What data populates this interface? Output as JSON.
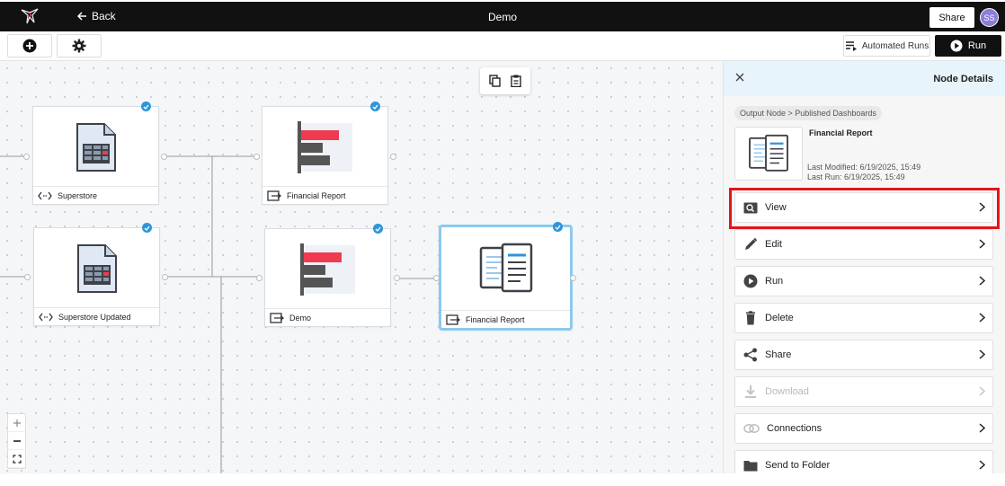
{
  "header": {
    "back_label": "Back",
    "title": "Demo",
    "share_label": "Share",
    "avatar_initials": "SS"
  },
  "toolbar": {
    "automated_runs_label": "Automated Runs",
    "run_label": "Run"
  },
  "canvas": {
    "nodes": [
      {
        "label": "Superstore",
        "type": "data-source",
        "selected": false
      },
      {
        "label": "Superstore Updated",
        "type": "data-source",
        "selected": false
      },
      {
        "label": "Financial Report",
        "type": "chart",
        "selected": false
      },
      {
        "label": "Demo",
        "type": "chart",
        "selected": false
      },
      {
        "label": "Financial Report",
        "type": "dashboard",
        "selected": true
      }
    ]
  },
  "panel": {
    "title": "Node Details",
    "breadcrumb": "Output Node > Published Dashboards",
    "node_name": "Financial Report",
    "last_modified": "Last Modified: 6/19/2025, 15:49",
    "last_run": "Last Run: 6/19/2025, 15:49",
    "actions": [
      {
        "label": "View",
        "icon": "view-icon",
        "enabled": true,
        "highlighted": true
      },
      {
        "label": "Edit",
        "icon": "pencil-icon",
        "enabled": true
      },
      {
        "label": "Run",
        "icon": "play-icon",
        "enabled": true
      },
      {
        "label": "Delete",
        "icon": "trash-icon",
        "enabled": true
      },
      {
        "label": "Share",
        "icon": "share-icon",
        "enabled": true
      },
      {
        "label": "Download",
        "icon": "download-icon",
        "enabled": false
      },
      {
        "label": "Connections",
        "icon": "connections-icon",
        "enabled": true
      },
      {
        "label": "Send to Folder",
        "icon": "folder-icon",
        "enabled": true
      }
    ]
  },
  "colors": {
    "accent_blue": "#2f95d9",
    "selection_border": "#8cc9ee",
    "highlight_red": "#e3141a",
    "chart_red": "#ef3b4f",
    "chart_gray": "#555555"
  }
}
